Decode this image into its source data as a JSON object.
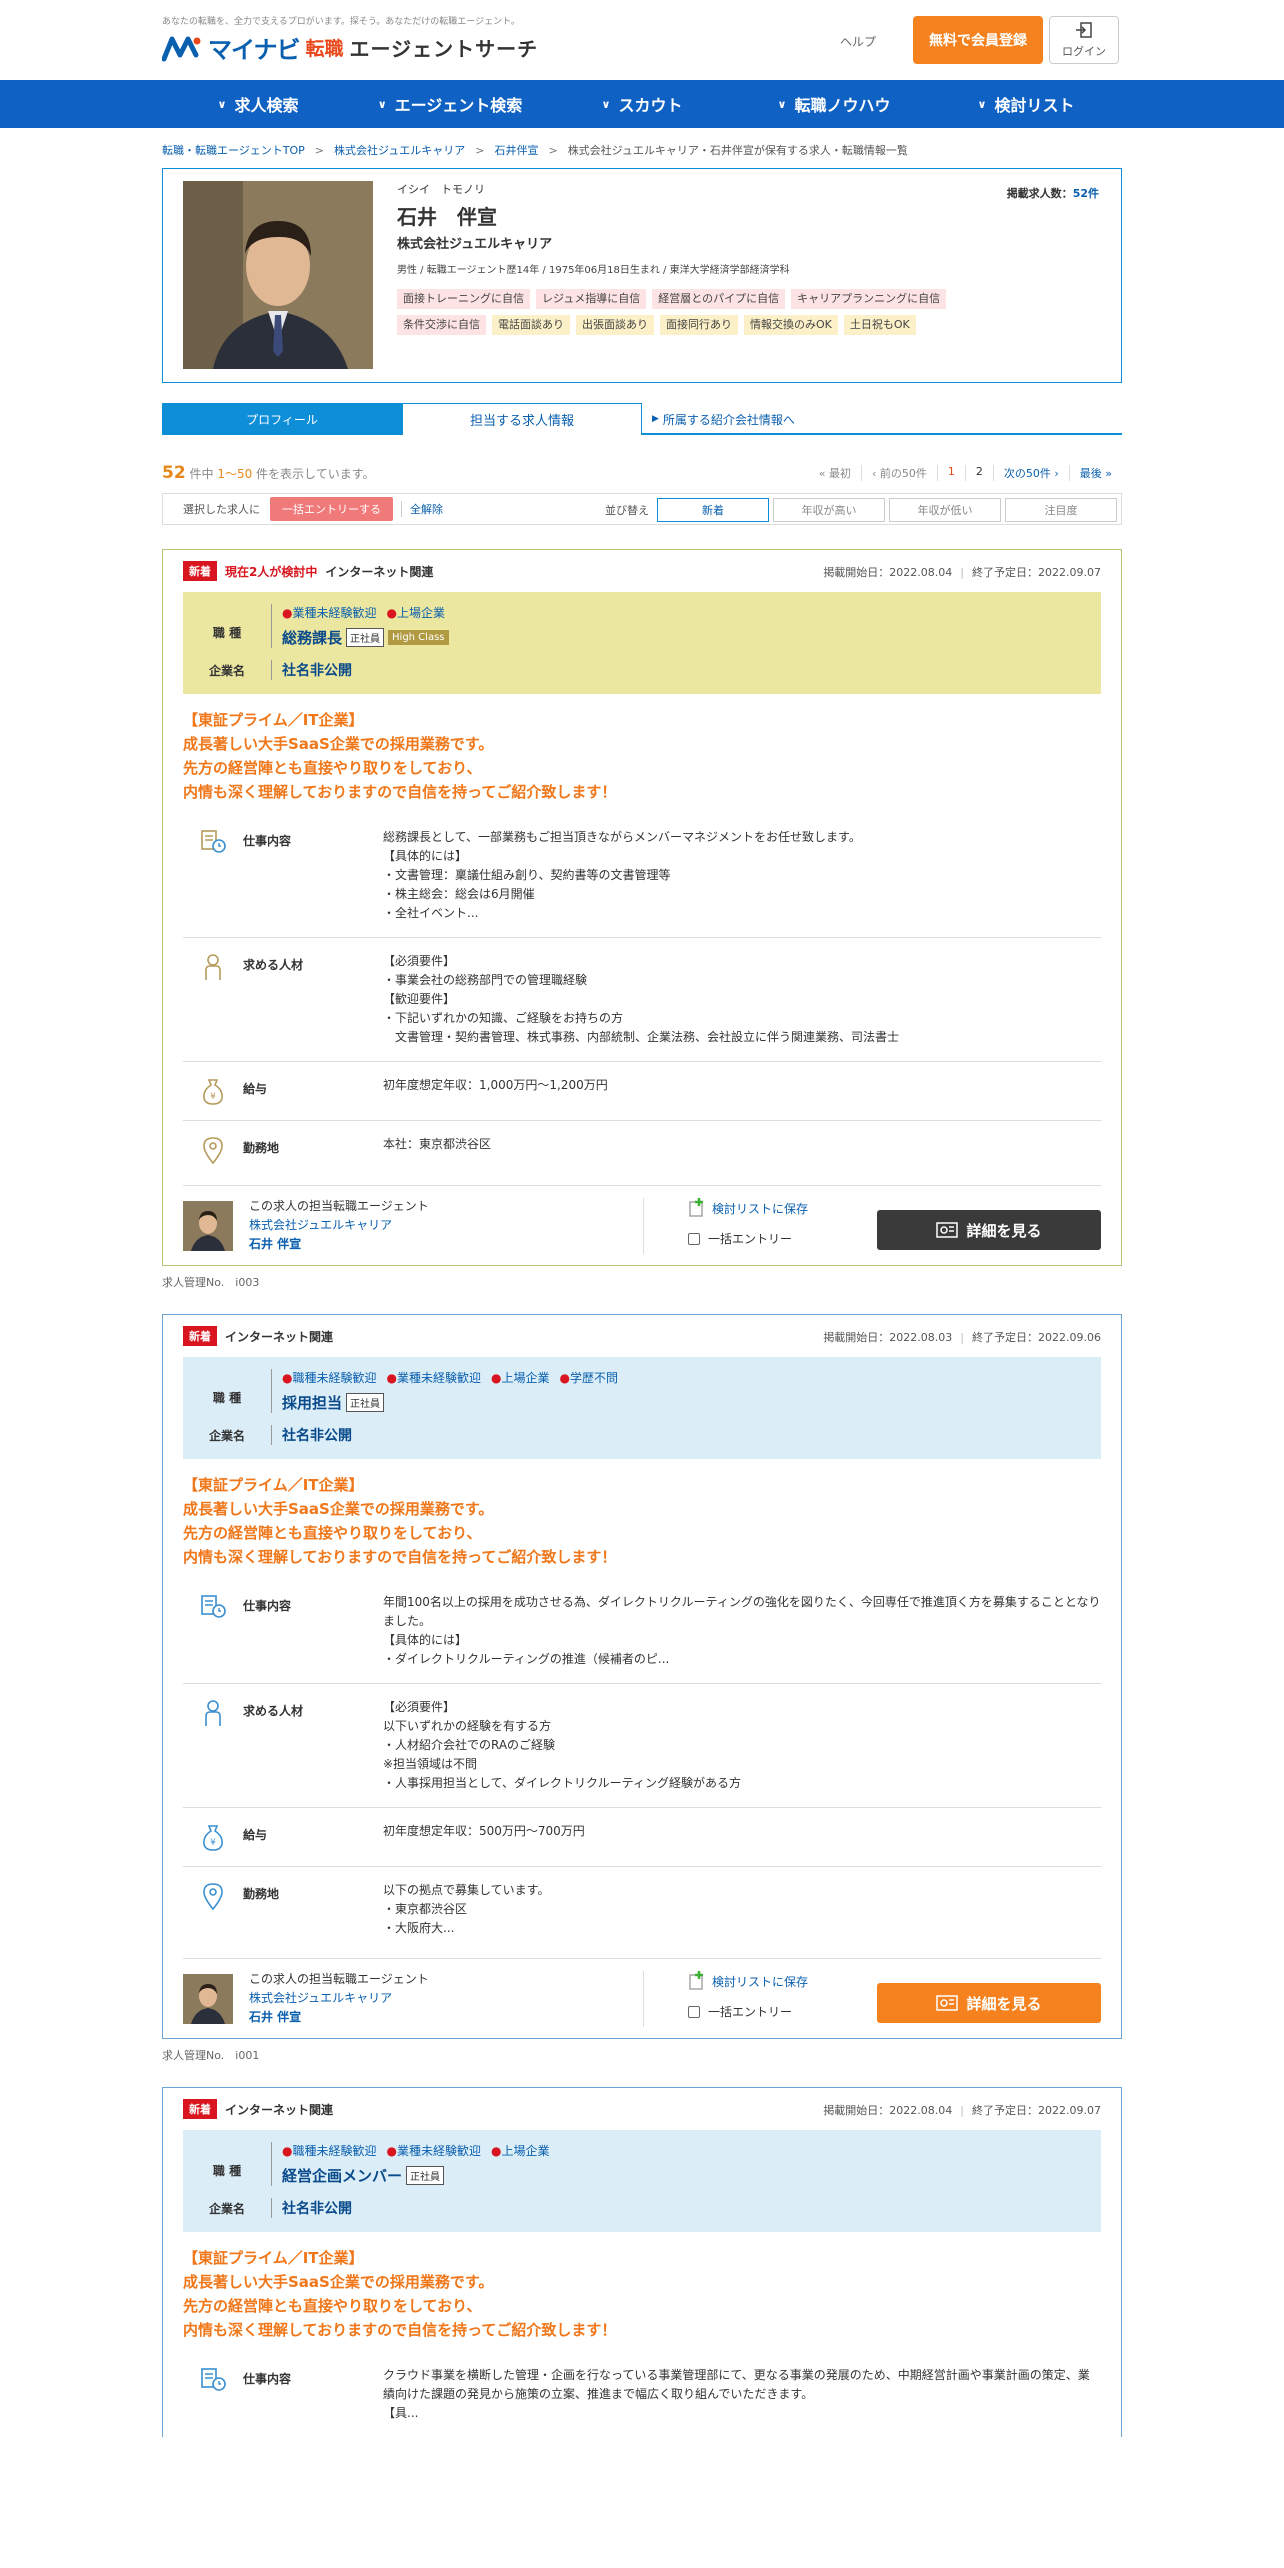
{
  "header": {
    "tagline": "あなたの転職を、全力で支えるプロがいます。探そう。あなただけの転職エージェント。",
    "logo_mynavi": "マイナビ",
    "logo_tenshoku": "転職",
    "logo_agent": "エージェントサーチ",
    "help": "ヘルプ",
    "register": "無料で会員登録",
    "login": "ログイン"
  },
  "nav": [
    "求人検索",
    "エージェント検索",
    "スカウト",
    "転職ノウハウ",
    "検討リスト"
  ],
  "breadcrumb": [
    "転職・転職エージェントTOP",
    "株式会社ジュエルキャリア",
    "石井伴宣",
    "株式会社ジュエルキャリア・石井伴宣が保有する求人・転職情報一覧"
  ],
  "profile": {
    "kana": "イシイ　トモノリ",
    "name": "石井　伴宣",
    "company": "株式会社ジュエルキャリア",
    "meta": "男性 / 転職エージェント歴14年 / 1975年06月18日生まれ / 東洋大学経済学部経済学科",
    "count_label": "掲載求人数：",
    "count_value": "52件",
    "tags_pink": [
      "面接トレーニングに自信",
      "レジュメ指導に自信",
      "経営層とのパイプに自信",
      "キャリアプランニングに自信",
      "条件交渉に自信"
    ],
    "tags_yellow": [
      "電話面談あり",
      "出張面談あり",
      "面接同行あり",
      "情報交換のみOK",
      "土日祝もOK"
    ]
  },
  "tabs": {
    "profile": "プロフィール",
    "jobs": "担当する求人情報",
    "company": "所属する紹介会社情報へ"
  },
  "results": {
    "total": "52",
    "mid1": " 件中 ",
    "range_start": "1〜",
    "range_end": "50",
    "suffix": " 件を表示しています。",
    "pager": [
      "« 最初",
      "‹ 前の50件",
      "1",
      "2",
      "次の50件 ›",
      "最後 »"
    ]
  },
  "select_bar": {
    "label": "選択した求人に",
    "bulk": "一括エントリーする",
    "clear": "全解除",
    "sort_label": "並び替え",
    "sort": [
      "新着",
      "年収が高い",
      "年収が低い",
      "注目度"
    ]
  },
  "jobs": [
    {
      "badge": "新着",
      "attention": "現在2人が検討中",
      "industry": "インターネット関連",
      "start": "掲載開始日：2022.08.04",
      "end": "終了予定日：2022.09.07",
      "job_label": "職 種",
      "features": [
        "業種未経験歓迎",
        "上場企業"
      ],
      "title": "総務課長",
      "emp": "正社員",
      "highclass": "High Class",
      "company_label": "企業名",
      "company": "社名非公開",
      "catch": "【東証プライム／IT企業】\n成長著しい大手SaaS企業での採用業務です。\n先方の経営陣とも直接やり取りをしており、\n内情も深く理解しておりますので自信を持ってご紹介致します！",
      "sections": [
        {
          "label": "仕事内容",
          "text": "総務課長として、一部業務もご担当頂きながらメンバーマネジメントをお任せ致します。\n【具体的には】\n・文書管理：稟議仕組み創り、契約書等の文書管理等\n・株主総会：総会は6月開催\n・全社イベント..."
        },
        {
          "label": "求める人材",
          "text": "【必須要件】\n・事業会社の総務部門での管理職経験\n【歓迎要件】\n・下記いずれかの知識、ご経験をお持ちの方\n　文書管理・契約書管理、株式事務、内部統制、企業法務、会社設立に伴う関連業務、司法書士"
        },
        {
          "label": "給与",
          "text": "初年度想定年収：1,000万円〜1,200万円"
        },
        {
          "label": "勤務地",
          "text": "本社：東京都渋谷区"
        }
      ],
      "agent_caption": "この求人の担当転職エージェント",
      "agent_company": "株式会社ジュエルキャリア",
      "agent_name": "石井 伴宣",
      "save": "検討リストに保存",
      "bulk": "一括エントリー",
      "detail": "詳細を見る",
      "job_no": "求人管理No.　i003"
    },
    {
      "badge": "新着",
      "industry": "インターネット関連",
      "start": "掲載開始日：2022.08.03",
      "end": "終了予定日：2022.09.06",
      "job_label": "職 種",
      "features": [
        "職種未経験歓迎",
        "業種未経験歓迎",
        "上場企業",
        "学歴不問"
      ],
      "title": "採用担当",
      "emp": "正社員",
      "company_label": "企業名",
      "company": "社名非公開",
      "catch": "【東証プライム／IT企業】\n成長著しい大手SaaS企業での採用業務です。\n先方の経営陣とも直接やり取りをしており、\n内情も深く理解しておりますので自信を持ってご紹介致します！",
      "sections": [
        {
          "label": "仕事内容",
          "text": "年間100名以上の採用を成功させる為、ダイレクトリクルーティングの強化を図りたく、今回専任で推進頂く方を募集することとなりました。\n【具体的には】\n・ダイレクトリクルーティングの推進（候補者のピ..."
        },
        {
          "label": "求める人材",
          "text": "【必須要件】\n以下いずれかの経験を有する方\n・人材紹介会社でのRAのご経験\n※担当領域は不問\n・人事採用担当として、ダイレクトリクルーティング経験がある方\n"
        },
        {
          "label": "給与",
          "text": "初年度想定年収：500万円〜700万円"
        },
        {
          "label": "勤務地",
          "text": "以下の拠点で募集しています。\n・東京都渋谷区\n・大阪府大..."
        }
      ],
      "agent_caption": "この求人の担当転職エージェント",
      "agent_company": "株式会社ジュエルキャリア",
      "agent_name": "石井 伴宣",
      "save": "検討リストに保存",
      "bulk": "一括エントリー",
      "detail": "詳細を見る",
      "job_no": "求人管理No.　i001"
    },
    {
      "badge": "新着",
      "industry": "インターネット関連",
      "start": "掲載開始日：2022.08.04",
      "end": "終了予定日：2022.09.07",
      "job_label": "職 種",
      "features": [
        "職種未経験歓迎",
        "業種未経験歓迎",
        "上場企業"
      ],
      "title": "経営企画メンバー",
      "emp": "正社員",
      "company_label": "企業名",
      "company": "社名非公開",
      "catch": "【東証プライム／IT企業】\n成長著しい大手SaaS企業での採用業務です。\n先方の経営陣とも直接やり取りをしており、\n内情も深く理解しておりますので自信を持ってご紹介致します！",
      "sections": [
        {
          "label": "仕事内容",
          "text": "クラウド事業を横断した管理・企画を行なっている事業管理部にて、更なる事業の発展のため、中期経営計画や事業計画の策定、業績向けた課題の発見から施策の立案、推進まで幅広く取り組んでいただきます。\n【具..."
        }
      ]
    }
  ],
  "colors": {
    "nav_blue": "#0f62c4",
    "accent_orange": "#f5821f",
    "new_red": "#d9161f",
    "card_yellow": "#ece7a0",
    "card_blue": "#dbeef8"
  }
}
